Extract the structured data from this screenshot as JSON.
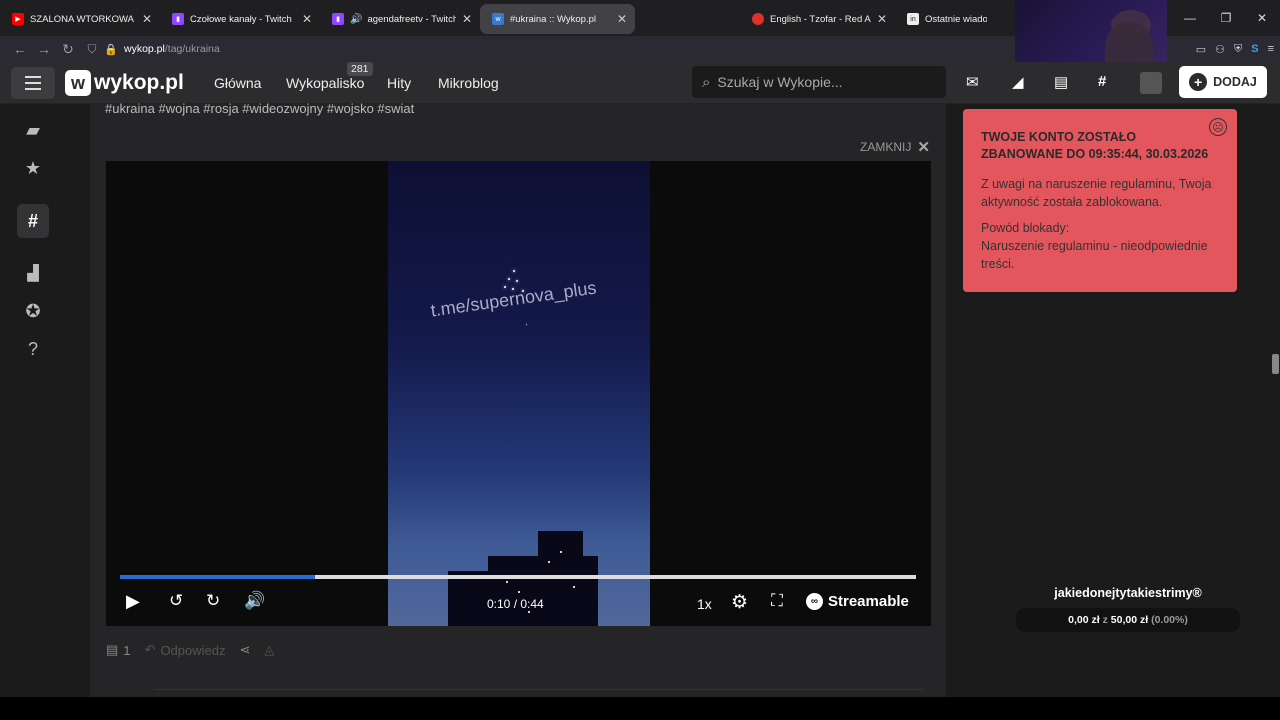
{
  "browser": {
    "tabs": [
      {
        "title": "SZALONA WTORKOWA NOC",
        "icon": "youtube-icon",
        "color": "#ff0000",
        "active": false
      },
      {
        "title": "Czołowe kanały - Twitch",
        "icon": "twitch-icon",
        "color": "#9146ff",
        "active": false
      },
      {
        "title": "agendafreetv - Twitch",
        "icon": "twitch-icon",
        "color": "#9146ff",
        "active": false,
        "audio": true
      },
      {
        "title": "#ukraina :: Wykop.pl",
        "icon": "wykop-icon",
        "color": "#3a79c9",
        "active": true
      },
      {
        "title": "English - Tzofar - Red Alert",
        "icon": "redalert-icon",
        "color": "#e0302c",
        "active": false
      },
      {
        "title": "Ostatnie wiadomości",
        "icon": "news-icon",
        "color": "#eeeeee",
        "active": false
      }
    ],
    "url_domain": "wykop.pl",
    "url_path": "/tag/ukraina"
  },
  "header": {
    "logo_text": "wykop.pl",
    "nav": [
      {
        "label": "Główna"
      },
      {
        "label": "Wykopalisko",
        "badge": "281"
      },
      {
        "label": "Hity"
      },
      {
        "label": "Mikroblog"
      }
    ],
    "search_placeholder": "Szukaj w Wykopie...",
    "add_label": "DODAJ"
  },
  "post": {
    "tags": "#ukraina #wojna #rosja #wideozwojny #wojsko #swiat",
    "close_label": "ZAMKNIJ",
    "video_watermark": "t.me/supernova_plus",
    "player": {
      "progress": 0.245,
      "time": "0:10 / 0:44",
      "speed": "1x",
      "brand": "Streamable"
    },
    "comment_count": "1",
    "reply_label": "Odpowiedz"
  },
  "ban": {
    "title": "TWOJE KONTO ZOSTAŁO ZBANOWANE DO 09:35:44, 30.03.2026",
    "body": "Z uwagi na naruszenie regulaminu, Twoja aktywność została zablokowana.",
    "reason_label": "Powód blokady:",
    "reason": "Naruszenie regulaminu - nieodpowiednie treści."
  },
  "donation": {
    "name": "jakiedonejtytakiestrimy®",
    "amount": "0,00 zł",
    "sep": "z",
    "goal": "50,00 zł",
    "percent": "(0.00%)"
  }
}
